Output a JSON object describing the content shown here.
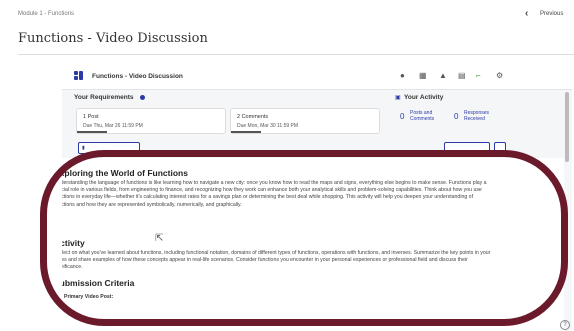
{
  "breadcrumb": "Module 1 - Functions",
  "nav": {
    "prev_label": "Previous"
  },
  "page_title": "Functions - Video Discussion",
  "tool": {
    "title": "Functions - Video Discussion",
    "brand_color": "#2c3aa8",
    "header_icons": [
      "chat-icon",
      "grid-icon",
      "bell-icon",
      "calendar-icon",
      "frame-icon",
      "gear-icon"
    ]
  },
  "requirements": {
    "label": "Your Requirements",
    "cards": [
      {
        "title": "1 Post",
        "due": "Due Thu, Mar 26 11:59 PM"
      },
      {
        "title": "2 Comments",
        "due": "Due Mon, Mar 30 11:59 PM"
      }
    ]
  },
  "activity": {
    "label": "Your Activity",
    "stats": [
      {
        "count": "0",
        "label": "Posts and Comments"
      },
      {
        "count": "0",
        "label": "Responses Received"
      }
    ]
  },
  "content": {
    "heading_world": "Exploring the World of Functions",
    "para_world": "Understanding the language of functions is like learning how to navigate a new city: once you know how to read the maps and signs, everything else begins to make sense. Functions play a crucial role in various fields, from engineering to finance, and recognizing how they work can enhance both your analytical skills and problem-solving capabilities. Think about how you use functions in everyday life—whether it's calculating interest rates for a savings plan or determining the best deal while shopping. This activity will help you deepen your understanding of functions and how they are represented symbolically, numerically, and graphically.",
    "heading_activity": "Activity",
    "para_activity": "Reflect on what you've learned about functions, including functional notation, domains of different types of functions, operations with functions, and inverses. Summarize the key points in your notes and share examples of how these concepts appear in real-life scenarios. Consider functions you encounter in your personal experiences or professional field and discuss their significance.",
    "heading_criteria": "Submission Criteria",
    "bullet_primary": "Primary Video Post:"
  },
  "highlight_color": "#6b1a2b",
  "help_label": "?"
}
